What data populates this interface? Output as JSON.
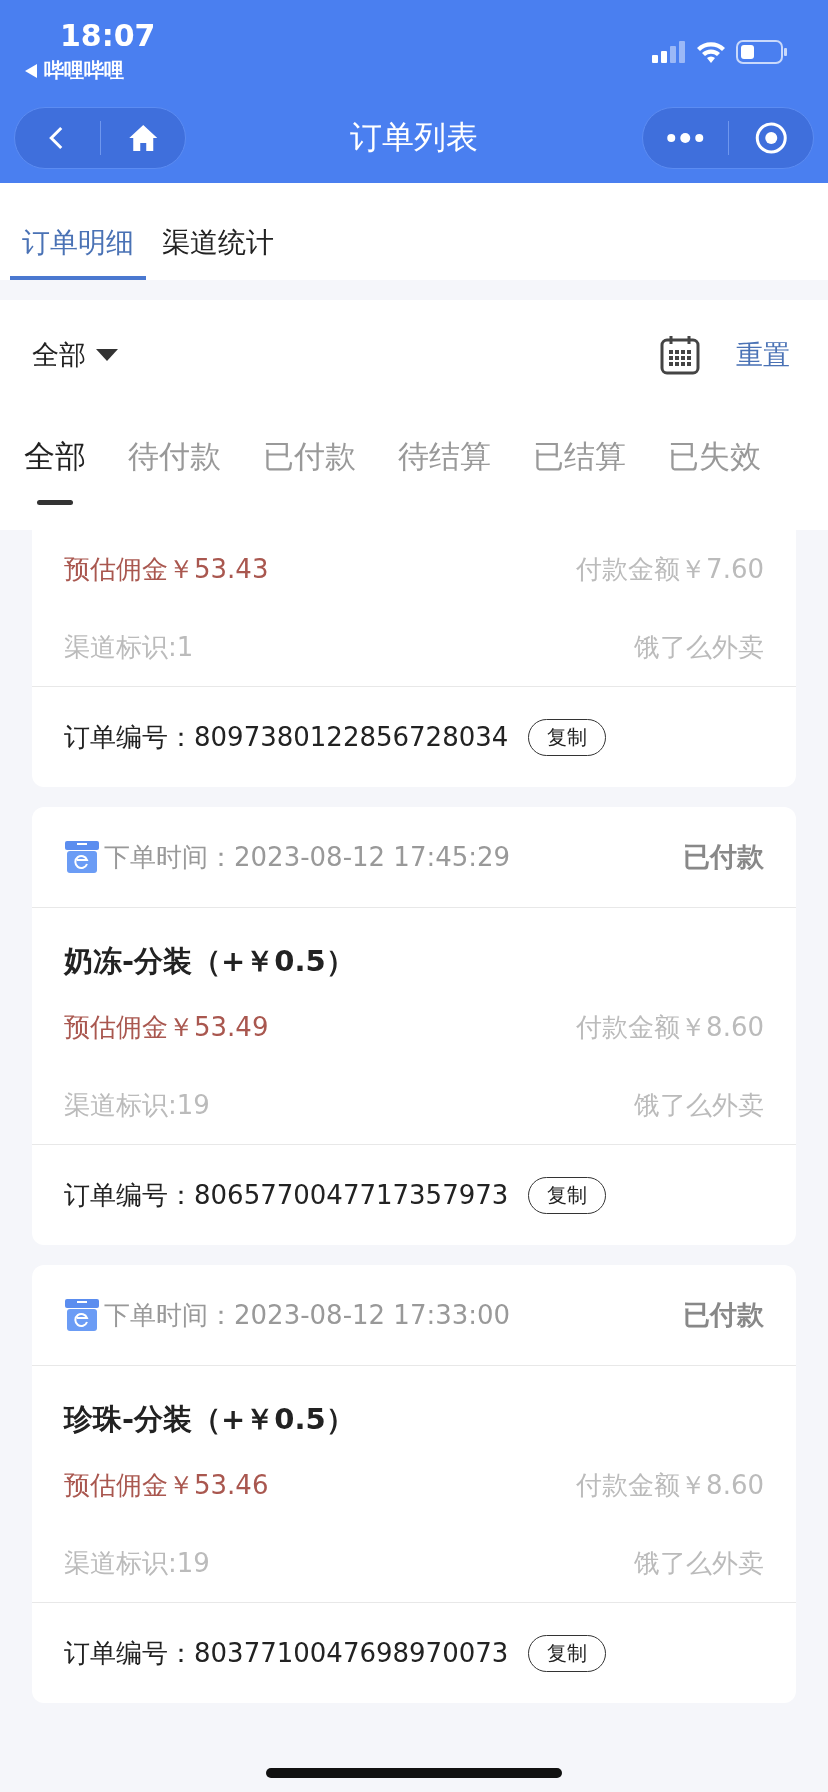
{
  "status_bar": {
    "time": "18:07",
    "back_app": "哔哩哔哩"
  },
  "nav": {
    "title": "订单列表"
  },
  "top_tabs": [
    {
      "label": "订单明细",
      "selected": true
    },
    {
      "label": "渠道统计",
      "selected": false
    }
  ],
  "filter": {
    "dropdown": "全部",
    "reset": "重置"
  },
  "status_tabs": [
    {
      "label": "全部",
      "selected": true
    },
    {
      "label": "待付款",
      "selected": false
    },
    {
      "label": "已付款",
      "selected": false
    },
    {
      "label": "待结算",
      "selected": false
    },
    {
      "label": "已结算",
      "selected": false
    },
    {
      "label": "已失效",
      "selected": false
    }
  ],
  "orders": [
    {
      "commission": "预估佣金￥53.43",
      "payment": "付款金额￥7.60",
      "channel": "渠道标识:1",
      "platform": "饿了么外卖",
      "order_label": "订单编号：",
      "order_no": "8097380122856728034",
      "copy": "复制"
    },
    {
      "time_label": "下单时间：",
      "time": "2023-08-12 17:45:29",
      "status": "已付款",
      "title": "奶冻-分装（+￥0.5）",
      "commission": "预估佣金￥53.49",
      "payment": "付款金额￥8.60",
      "channel": "渠道标识:19",
      "platform": "饿了么外卖",
      "order_label": "订单编号：",
      "order_no": "8065770047717357973",
      "copy": "复制"
    },
    {
      "time_label": "下单时间：",
      "time": "2023-08-12 17:33:00",
      "status": "已付款",
      "title": "珍珠-分装（+￥0.5）",
      "commission": "预估佣金￥53.46",
      "payment": "付款金额￥8.60",
      "channel": "渠道标识:19",
      "platform": "饿了么外卖",
      "order_label": "订单编号：",
      "order_no": "8037710047698970073",
      "copy": "复制"
    }
  ]
}
